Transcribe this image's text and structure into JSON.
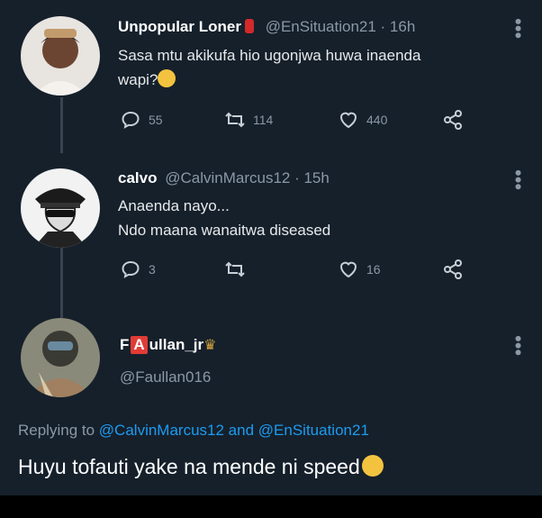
{
  "tweets": [
    {
      "name": "Unpopular Loner",
      "handle": "@EnSituation21",
      "time": "· 16h",
      "text_line1": "Sasa mtu akikufa hio ugonjwa huwa inaenda",
      "text_line2": "wapi?",
      "replies": "55",
      "retweets": "114",
      "likes": "440"
    },
    {
      "name": "calvo",
      "handle": "@CalvinMarcus12",
      "time": "· 15h",
      "text_line1": "Anaenda nayo...",
      "text_line2": "Ndo maana wanaitwa diseased",
      "replies": "3",
      "retweets": "",
      "likes": "16"
    }
  ],
  "reply": {
    "name_prefix": "F",
    "name_box": "A",
    "name_suffix": "ullan_jr",
    "handle": "@Faullan016",
    "replying_prefix": "Replying to",
    "replying_to_1": "@CalvinMarcus12",
    "replying_and": "and",
    "replying_to_2": "@EnSituation21",
    "text": "Huyu tofauti yake na mende ni speed"
  },
  "colors": {
    "background": "#15202b",
    "link": "#1d9bf0",
    "muted": "#8b98a5"
  },
  "icons": [
    "reply-icon",
    "retweet-icon",
    "like-icon",
    "share-icon",
    "more-icon"
  ]
}
